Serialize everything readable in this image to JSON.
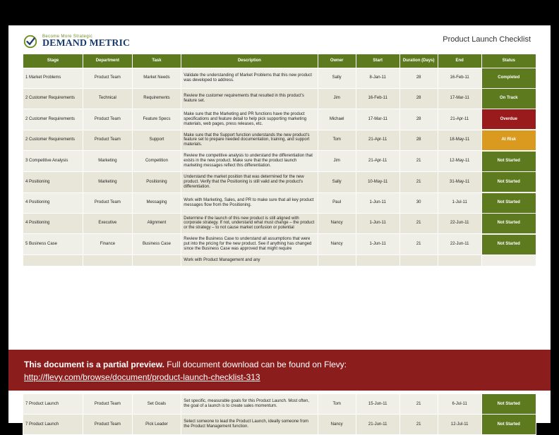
{
  "logo": {
    "tagline": "Become More Strategic",
    "main": "DEMAND METRIC"
  },
  "title": "Product Launch Checklist",
  "columns": [
    "Stage",
    "Department",
    "Task",
    "Description",
    "Owner",
    "Start",
    "Duration (Days)",
    "End",
    "Status"
  ],
  "status_map": {
    "Completed": "sc-completed",
    "On Track": "sc-ontrack",
    "Overdue": "sc-overdue",
    "At Risk": "sc-atrisk",
    "Not Started": "sc-notstart"
  },
  "rows": [
    {
      "stage": "1 Market Problems",
      "dept": "Product Team",
      "task": "Market Needs",
      "desc": "Validate the understanding of Market Problems that this new product was developed to address.",
      "owner": "Sally",
      "start": "8-Jan-11",
      "dur": "28",
      "end": "16-Feb-11",
      "status": "Completed"
    },
    {
      "stage": "2 Customer Requirements",
      "dept": "Technical",
      "task": "Requirements",
      "desc": "Review the customer requirements that resulted in this product's feature set.",
      "owner": "Jim",
      "start": "16-Feb-11",
      "dur": "28",
      "end": "17-Mar-11",
      "status": "On Track"
    },
    {
      "stage": "2 Customer Requirements",
      "dept": "Product Team",
      "task": "Feature Specs",
      "desc": "Make sure that the Marketing and PR functions have the product specifications and feature detail to help pick supporting marketing materials, web pages, press releases, etc.",
      "owner": "Michael",
      "start": "17-Mar-11",
      "dur": "28",
      "end": "21-Apr-11",
      "status": "Overdue"
    },
    {
      "stage": "2 Customer Requirements",
      "dept": "Product Team",
      "task": "Support",
      "desc": "Make sure that the Support function understands the new product's feature set to prepare needed documentation, training, and support materials.",
      "owner": "Tom",
      "start": "21-Apr-11",
      "dur": "28",
      "end": "18-May-11",
      "status": "At Risk"
    },
    {
      "stage": "3 Competitive Analysis",
      "dept": "Marketing",
      "task": "Competition",
      "desc": "Review the competitive analysis to understand the differentiation that exists in the new product. Make sure that the product launch marketing messages reflect this differentiation.",
      "owner": "Jim",
      "start": "21-Apr-11",
      "dur": "21",
      "end": "12-May-11",
      "status": "Not Started"
    },
    {
      "stage": "4 Positioning",
      "dept": "Marketing",
      "task": "Positioning",
      "desc": "Understand the market position that was determined for the new product. Verify that the Positioning is still valid and the product's differentiation.",
      "owner": "Sally",
      "start": "10-May-11",
      "dur": "21",
      "end": "31-May-11",
      "status": "Not Started"
    },
    {
      "stage": "4 Positioning",
      "dept": "Product Team",
      "task": "Messaging",
      "desc": "Work with Marketing, Sales, and PR to make sure that all key product messages flow from the Positioning.",
      "owner": "Paul",
      "start": "1-Jun-11",
      "dur": "30",
      "end": "1-Jul-11",
      "status": "Not Started"
    },
    {
      "stage": "4 Positioning",
      "dept": "Executive",
      "task": "Alignment",
      "desc": "Determine if the launch of this new product is still aligned with corporate strategy. If not, understand what must change – the product or the strategy – to not cause market confusion or potential",
      "owner": "Nancy",
      "start": "1-Jun-11",
      "dur": "21",
      "end": "22-Jun-11",
      "status": "Not Started"
    },
    {
      "stage": "5 Business Case",
      "dept": "Finance",
      "task": "Business Case",
      "desc": "Review the Business Case to understand all assumptions that were put into the pricing for the new product. See if anything has changed since the Business Case was approved that might require",
      "owner": "Nancy",
      "start": "1-Jun-11",
      "dur": "21",
      "end": "22-Jun-11",
      "status": "Not Started"
    },
    {
      "stage": "",
      "dept": "",
      "task": "",
      "desc": "Work with Product Management and any",
      "owner": "",
      "start": "",
      "dur": "",
      "end": "",
      "status": ""
    }
  ],
  "rows_after": [
    {
      "stage": "7 Product Launch",
      "dept": "Product Team",
      "task": "Set Goals",
      "desc": "Set specific, measurable goals for this Product Launch. Most often, the goal of a launch is to create sales momentum.",
      "owner": "Tom",
      "start": "15-Jun-11",
      "dur": "21",
      "end": "6-Jul-11",
      "status": "Not Started"
    },
    {
      "stage": "7 Product Launch",
      "dept": "Product Team",
      "task": "Pick Leader",
      "desc": "Select someone to lead the Product Launch, ideally someone from the Product Management function.",
      "owner": "Nancy",
      "start": "21-Jun-11",
      "dur": "21",
      "end": "12-Jul-11",
      "status": "Not Started"
    }
  ],
  "banner": {
    "bold": "This document is a partial preview.",
    "rest": "  Full document download can be found on Flevy:",
    "link": "http://flevy.com/browse/document/product-launch-checklist-313"
  }
}
